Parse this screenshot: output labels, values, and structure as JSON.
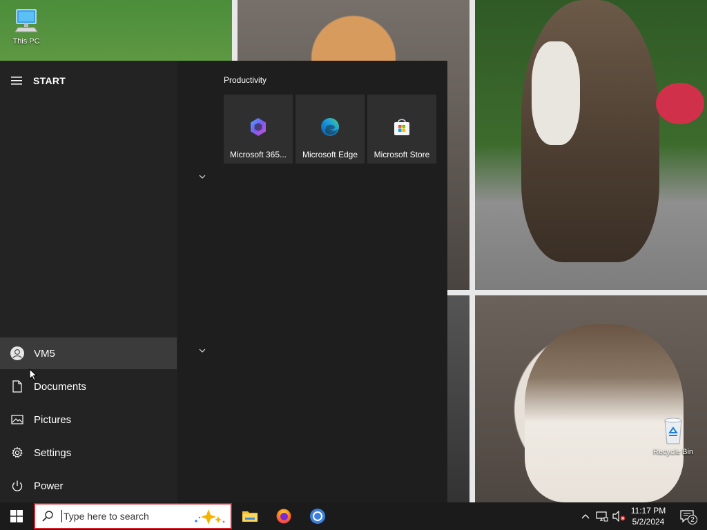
{
  "desktop": {
    "icons": [
      {
        "label": "This PC"
      },
      {
        "label": "Recycle Bin"
      }
    ]
  },
  "start_menu": {
    "title": "START",
    "group_title": "Productivity",
    "tiles": [
      {
        "label": "Microsoft 365...",
        "icon": "microsoft-365-icon"
      },
      {
        "label": "Microsoft Edge",
        "icon": "edge-icon"
      },
      {
        "label": "Microsoft Store",
        "icon": "store-icon"
      }
    ],
    "side_items": [
      {
        "label": "VM5",
        "icon": "user-avatar-icon"
      },
      {
        "label": "Documents",
        "icon": "document-icon"
      },
      {
        "label": "Pictures",
        "icon": "pictures-icon"
      },
      {
        "label": "Settings",
        "icon": "gear-icon"
      },
      {
        "label": "Power",
        "icon": "power-icon"
      }
    ]
  },
  "taskbar": {
    "search_placeholder": "Type here to search",
    "apps": [
      "file-explorer-icon",
      "firefox-icon",
      "chrome-icon"
    ],
    "clock_time": "11:17 PM",
    "clock_date": "5/2/2024",
    "notification_count": "2"
  },
  "colors": {
    "start_left_bg": "#232323",
    "start_right_bg": "#1e1e1e",
    "tile_bg": "#2f2f2f",
    "taskbar_bg": "#1b1b1b",
    "search_border": "#d81e2a"
  }
}
